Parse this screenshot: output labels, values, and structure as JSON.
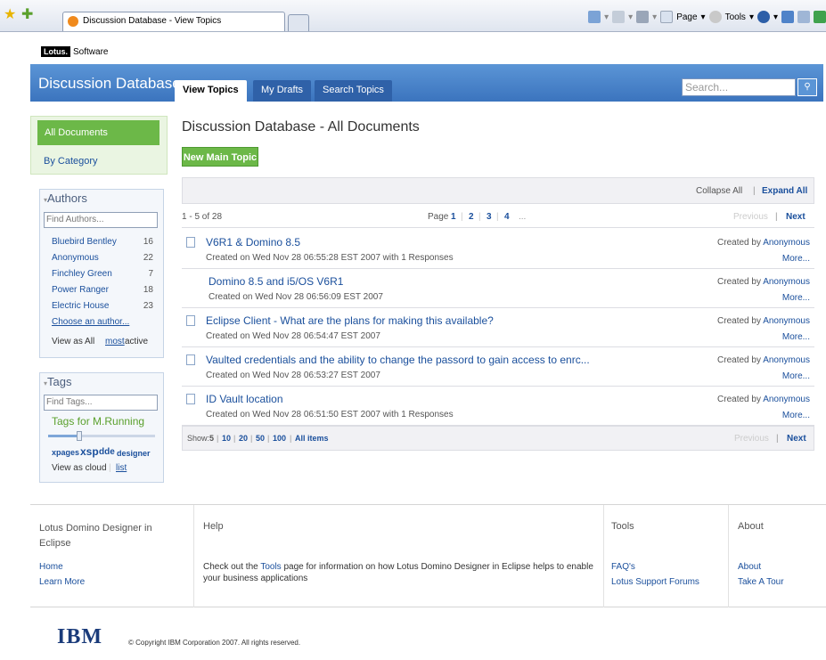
{
  "browser": {
    "tab_title": "Discussion Database - View Topics",
    "tools": [
      {
        "label": "Page",
        "icon": "page-icon"
      },
      {
        "label": "Tools",
        "icon": "gear-icon"
      }
    ]
  },
  "header": {
    "logo_text": "Lotus.",
    "software_text": "Software"
  },
  "banner": {
    "title": "Discussion Database",
    "tabs": [
      "View Topics",
      "My Drafts",
      "Search Topics"
    ],
    "search_placeholder": "Search..."
  },
  "nav": {
    "all_documents": "All Documents",
    "by_category": "By Category"
  },
  "authors": {
    "heading": "Authors",
    "find_placeholder": "Find Authors...",
    "list": [
      {
        "name": "Bluebird Bentley",
        "count": "16"
      },
      {
        "name": "Anonymous",
        "count": "22"
      },
      {
        "name": "Finchley Green",
        "count": "7"
      },
      {
        "name": "Power Ranger",
        "count": "18"
      },
      {
        "name": "Electric House",
        "count": "23"
      }
    ],
    "choose": "Choose an author...",
    "view_as": "View as All",
    "most": "most",
    "active": "active"
  },
  "tags": {
    "heading": "Tags",
    "find_placeholder": "Find Tags...",
    "for_user": "Tags for M.Running",
    "words": [
      "xpages",
      "xsp",
      "dde",
      "designer"
    ],
    "view_as_cloud": "View as cloud",
    "list_link": "list"
  },
  "main": {
    "title": "Discussion Database - All Documents",
    "new_topic": "New Main Topic",
    "collapse_all": "Collapse All",
    "expand_all": "Expand All",
    "range": "1 - 5 of 28",
    "page_label": "Page",
    "pages": [
      "1",
      "2",
      "3",
      "4",
      "..."
    ],
    "previous": "Previous",
    "next": "Next",
    "show_label": "Show:",
    "show_options": [
      "5",
      "10",
      "20",
      "50",
      "100",
      "All items"
    ],
    "created_by": "Created by",
    "more": "More...",
    "topics": [
      {
        "title": "V6R1 & Domino 8.5",
        "meta": "Created on Wed Nov 28 06:55:28 EST 2007 with 1 Responses",
        "author": "Anonymous",
        "icon": true
      },
      {
        "title": "Domino 8.5 and i5/OS V6R1",
        "meta": "Created on Wed Nov 28 06:56:09 EST 2007",
        "author": "Anonymous",
        "icon": false
      },
      {
        "title": "Eclipse Client - What are the plans for making this available?",
        "meta": "Created on Wed Nov 28 06:54:47 EST 2007",
        "author": "Anonymous",
        "icon": true
      },
      {
        "title": "Vaulted credentials and the ability to change the passord to gain access to enrc...",
        "meta": "Created on Wed Nov 28 06:53:27 EST 2007",
        "author": "Anonymous",
        "icon": true
      },
      {
        "title": "ID Vault location",
        "meta": "Created on Wed Nov 28 06:51:50 EST 2007 with 1 Responses",
        "author": "Anonymous",
        "icon": true
      }
    ]
  },
  "footer": {
    "col1_heading": "Lotus Domino Designer in Eclipse",
    "col1_links": [
      "Home",
      "Learn More"
    ],
    "help_heading": "Help",
    "help_text_before": "Check out the",
    "help_link": "Tools",
    "help_text_after": "page for information on how Lotus Domino Designer in Eclipse helps to enable",
    "help_text_line2": "your business applications",
    "tools_heading": "Tools",
    "tools_links": [
      "FAQ's",
      "Lotus Support Forums"
    ],
    "about_heading": "About",
    "about_links": [
      "About",
      "Take A Tour"
    ]
  },
  "copyright": {
    "logo": "IBM",
    "text": "© Copyright IBM Corporation 2007. All rights reserved."
  },
  "colors": {
    "banner_blue": "#3b74be",
    "accent_green": "#6cb848",
    "link_blue": "#1a4f9c"
  }
}
